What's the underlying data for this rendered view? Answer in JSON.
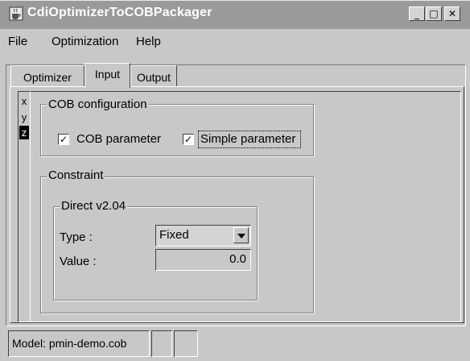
{
  "window": {
    "title": "CdiOptimizerToCOBPackager",
    "minimize_glyph": "_",
    "maximize_glyph": "□",
    "close_glyph": "✕",
    "app_icon": "java-cup-icon"
  },
  "menu": [
    "File",
    "Optimization",
    "Help"
  ],
  "tabs": [
    {
      "label": "Optimizer",
      "active": false
    },
    {
      "label": "Input",
      "active": true
    },
    {
      "label": "Output",
      "active": false
    }
  ],
  "side_tabs": [
    {
      "label": "x",
      "active": false
    },
    {
      "label": "y",
      "active": false
    },
    {
      "label": "z",
      "active": true
    }
  ],
  "cob_config": {
    "title": "COB configuration",
    "cob_parameter": {
      "label": "COB parameter",
      "checked": true,
      "mark": "✓"
    },
    "simple_parameter": {
      "label": "Simple parameter",
      "checked": true,
      "mark": "✓"
    }
  },
  "constraint": {
    "title": "Constraint",
    "direct": {
      "title": "Direct v2.04",
      "type_label": "Type :",
      "type_value": "Fixed",
      "value_label": "Value :",
      "value_value": "0.0"
    }
  },
  "status": {
    "model": "Model: pmin-demo.cob",
    "cell2": "",
    "cell3": ""
  }
}
